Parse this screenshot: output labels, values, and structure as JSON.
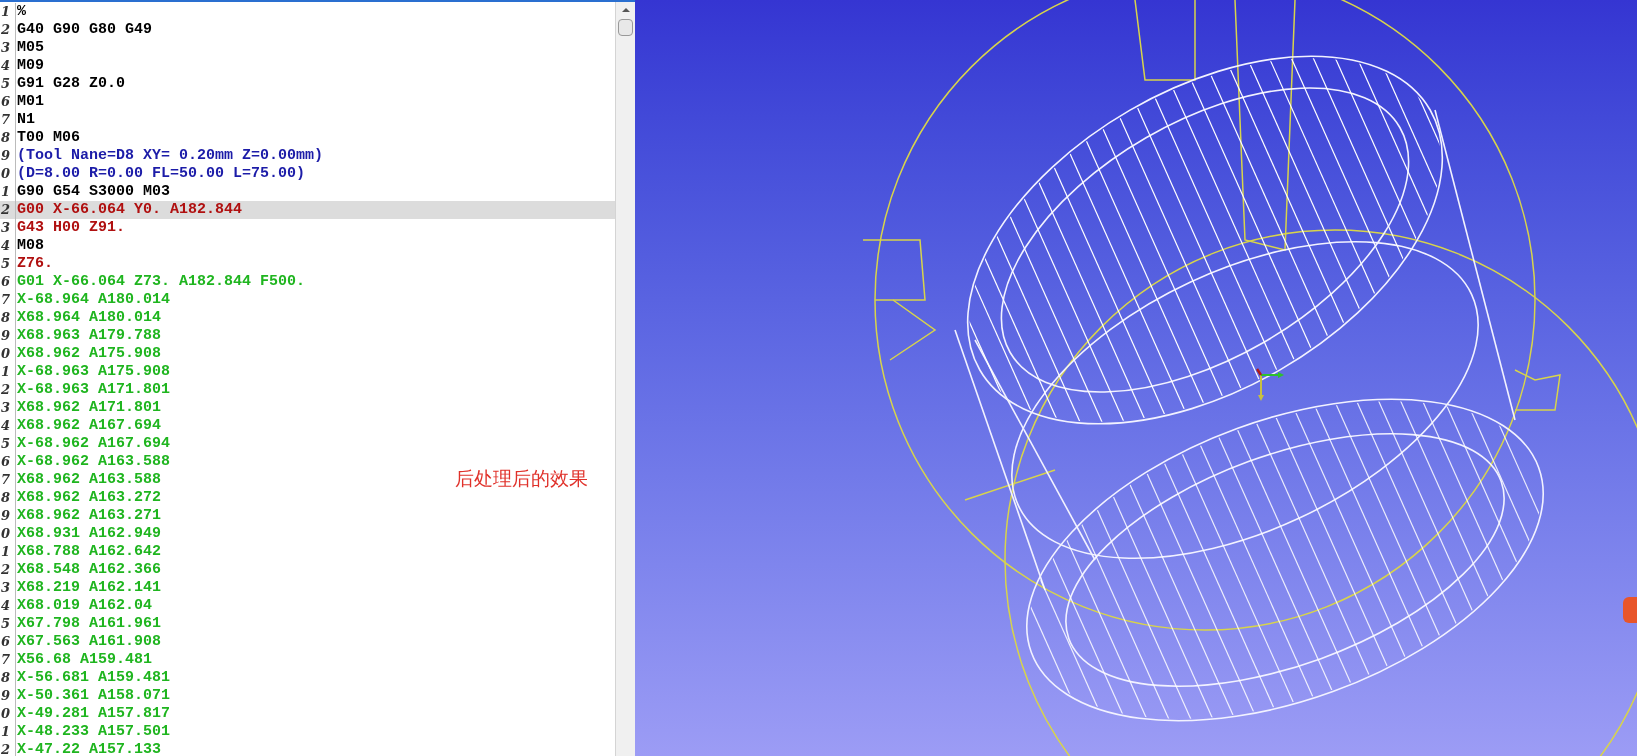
{
  "editor": {
    "lines": [
      {
        "number": "1",
        "code": "%",
        "kind": "plain",
        "selected": false
      },
      {
        "number": "2",
        "code": "G40 G90 G80 G49",
        "kind": "plain",
        "selected": false
      },
      {
        "number": "3",
        "code": "M05",
        "kind": "plain",
        "selected": false
      },
      {
        "number": "4",
        "code": "M09",
        "kind": "plain",
        "selected": false
      },
      {
        "number": "5",
        "code": "G91 G28 Z0.0",
        "kind": "plain",
        "selected": false
      },
      {
        "number": "6",
        "code": "M01",
        "kind": "plain",
        "selected": false
      },
      {
        "number": "7",
        "code": "N1",
        "kind": "plain",
        "selected": false
      },
      {
        "number": "8",
        "code": "T00 M06",
        "kind": "plain",
        "selected": false
      },
      {
        "number": "9",
        "code": "(Tool Nane=D8 XY= 0.20mm Z=0.00mm)",
        "kind": "comment",
        "selected": false
      },
      {
        "number": "0",
        "code": "(D=8.00 R=0.00 FL=50.00 L=75.00)",
        "kind": "comment",
        "selected": false
      },
      {
        "number": "1",
        "code": "G90 G54 S3000 M03",
        "kind": "plain",
        "selected": false
      },
      {
        "number": "2",
        "code": "G00 X-66.064 Y0. A182.844",
        "kind": "rapid",
        "selected": true
      },
      {
        "number": "3",
        "code": "G43 H00 Z91.",
        "kind": "rapid",
        "selected": false
      },
      {
        "number": "4",
        "code": "M08",
        "kind": "plain",
        "selected": false
      },
      {
        "number": "5",
        "code": "Z76.",
        "kind": "rapid",
        "selected": false
      },
      {
        "number": "6",
        "code": "G01 X-66.064 Z73. A182.844 F500.",
        "kind": "feed",
        "selected": false
      },
      {
        "number": "7",
        "code": "X-68.964 A180.014",
        "kind": "feed",
        "selected": false
      },
      {
        "number": "8",
        "code": "X68.964 A180.014",
        "kind": "feed",
        "selected": false
      },
      {
        "number": "9",
        "code": "X68.963 A179.788",
        "kind": "feed",
        "selected": false
      },
      {
        "number": "0",
        "code": "X68.962 A175.908",
        "kind": "feed",
        "selected": false
      },
      {
        "number": "1",
        "code": "X-68.963 A175.908",
        "kind": "feed",
        "selected": false
      },
      {
        "number": "2",
        "code": "X-68.963 A171.801",
        "kind": "feed",
        "selected": false
      },
      {
        "number": "3",
        "code": "X68.962 A171.801",
        "kind": "feed",
        "selected": false
      },
      {
        "number": "4",
        "code": "X68.962 A167.694",
        "kind": "feed",
        "selected": false
      },
      {
        "number": "5",
        "code": "X-68.962 A167.694",
        "kind": "feed",
        "selected": false
      },
      {
        "number": "6",
        "code": "X-68.962 A163.588",
        "kind": "feed",
        "selected": false
      },
      {
        "number": "7",
        "code": "X68.962 A163.588",
        "kind": "feed",
        "selected": false
      },
      {
        "number": "8",
        "code": "X68.962 A163.272",
        "kind": "feed",
        "selected": false
      },
      {
        "number": "9",
        "code": "X68.962 A163.271",
        "kind": "feed",
        "selected": false
      },
      {
        "number": "0",
        "code": "X68.931 A162.949",
        "kind": "feed",
        "selected": false
      },
      {
        "number": "1",
        "code": "X68.788 A162.642",
        "kind": "feed",
        "selected": false
      },
      {
        "number": "2",
        "code": "X68.548 A162.366",
        "kind": "feed",
        "selected": false
      },
      {
        "number": "3",
        "code": "X68.219 A162.141",
        "kind": "feed",
        "selected": false
      },
      {
        "number": "4",
        "code": "X68.019 A162.04",
        "kind": "feed",
        "selected": false
      },
      {
        "number": "5",
        "code": "X67.798 A161.961",
        "kind": "feed",
        "selected": false
      },
      {
        "number": "6",
        "code": "X67.563 A161.908",
        "kind": "feed",
        "selected": false
      },
      {
        "number": "7",
        "code": "X56.68 A159.481",
        "kind": "feed",
        "selected": false
      },
      {
        "number": "8",
        "code": "X-56.681 A159.481",
        "kind": "feed",
        "selected": false
      },
      {
        "number": "9",
        "code": "X-50.361 A158.071",
        "kind": "feed",
        "selected": false
      },
      {
        "number": "0",
        "code": "X-49.281 A157.817",
        "kind": "feed",
        "selected": false
      },
      {
        "number": "1",
        "code": "X-48.233 A157.501",
        "kind": "feed",
        "selected": false
      },
      {
        "number": "2",
        "code": "X-47.22 A157.133",
        "kind": "feed",
        "selected": false
      }
    ]
  },
  "annotation": "后处理后的效果"
}
